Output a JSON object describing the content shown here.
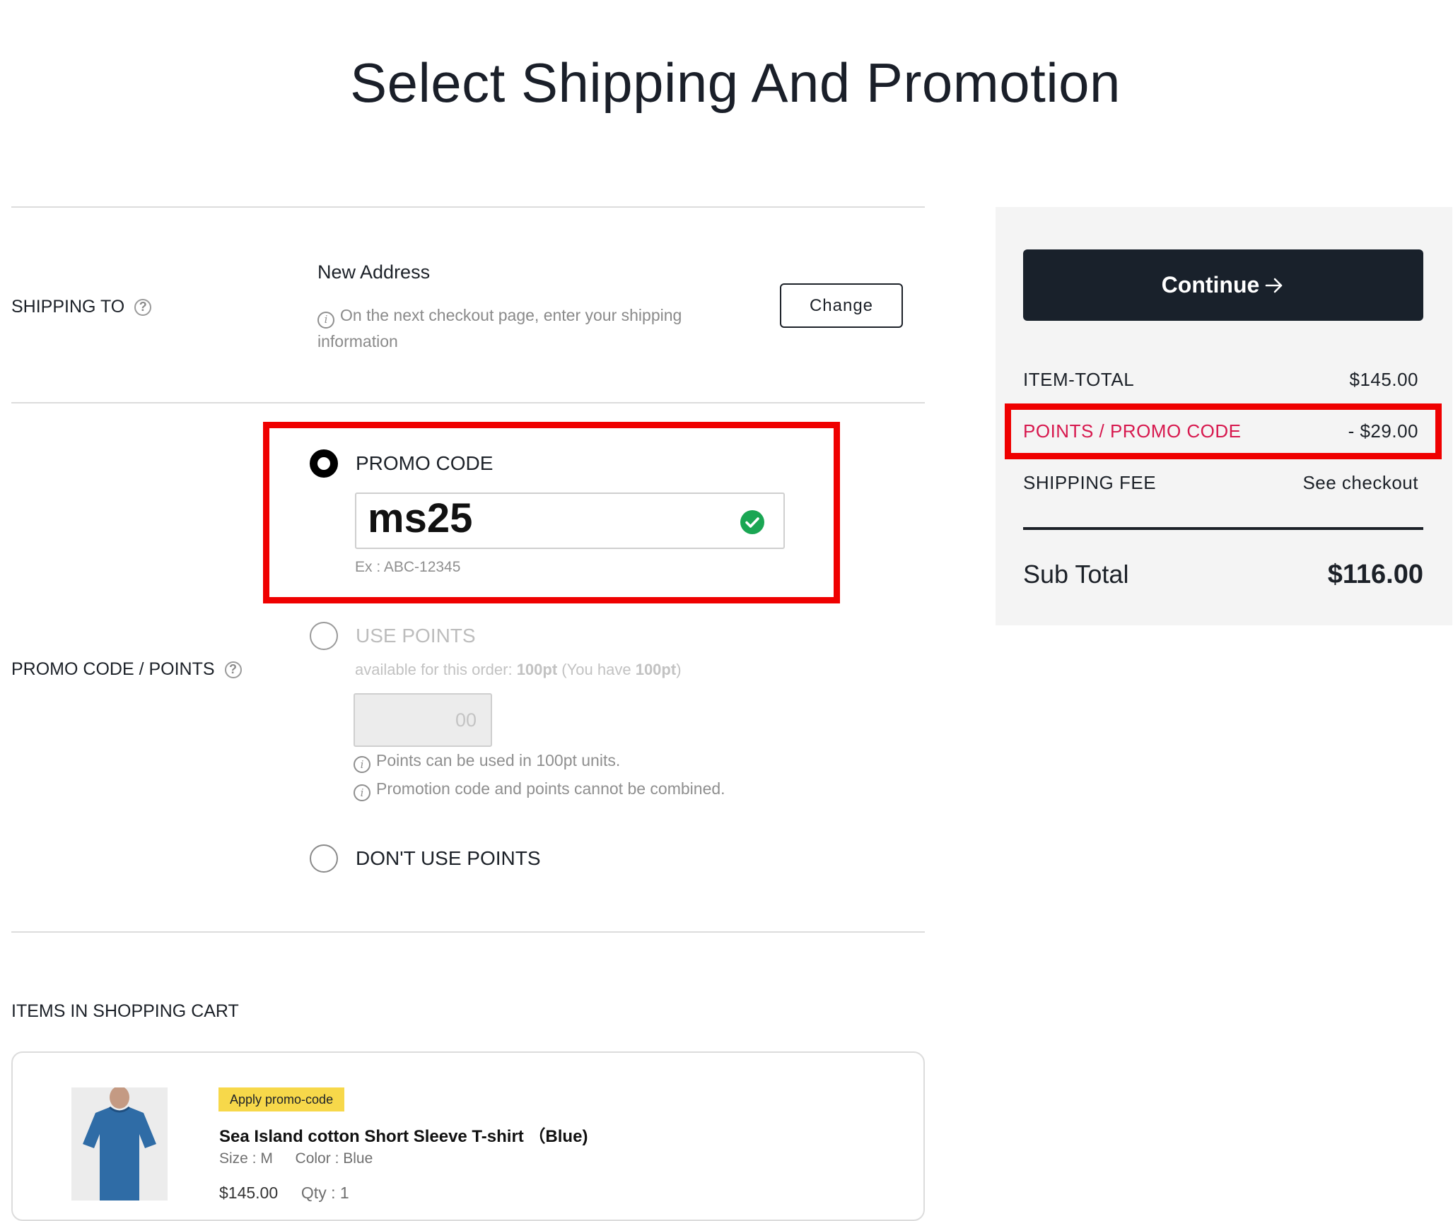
{
  "page": {
    "title": "Select Shipping And Promotion"
  },
  "shipping": {
    "label": "SHIPPING TO",
    "address_title": "New Address",
    "note_line1": "On the next checkout page, enter your shipping",
    "note_line2": "information",
    "change_label": "Change"
  },
  "promo": {
    "section_label": "PROMO CODE / POINTS",
    "options": {
      "promo_code": {
        "label": "PROMO CODE",
        "selected": true
      },
      "use_points": {
        "label": "USE POINTS",
        "selected": false
      },
      "dont_use_points": {
        "label": "DON'T USE POINTS",
        "selected": false
      }
    },
    "code_value": "ms25",
    "code_hint": "Ex : ABC-12345",
    "points": {
      "available_prefix": "available for this order:",
      "available_value": "100pt",
      "you_have_prefix": "(You have",
      "you_have_value": "100pt",
      "you_have_suffix": ")",
      "input_placeholder": "00",
      "note1": "Points can be used in 100pt units.",
      "note2": "Promotion code and points cannot be combined."
    }
  },
  "cart": {
    "section_label": "ITEMS IN SHOPPING CART",
    "item": {
      "badge": "Apply promo-code",
      "name": "Sea Island cotton Short Sleeve T-shirt （Blue)",
      "size": "Size : M",
      "color": "Color : Blue",
      "price": "$145.00",
      "qty": "Qty : 1"
    }
  },
  "summary": {
    "continue_label": "Continue",
    "item_total_label": "ITEM-TOTAL",
    "item_total_value": "$145.00",
    "promo_label": "POINTS / PROMO CODE",
    "promo_value": "- $29.00",
    "shipping_label": "SHIPPING FEE",
    "shipping_value": "See checkout",
    "subtotal_label": "Sub Total",
    "subtotal_value": "$116.00"
  },
  "colors": {
    "highlight_red": "#ef0000",
    "promo_pink": "#d7184e",
    "button_dark": "#19212b",
    "success_green": "#1aa653",
    "badge_yellow": "#f7d84a"
  },
  "icons": {
    "help": "help-circle-icon",
    "info": "info-icon",
    "check": "check-circle-icon",
    "arrow": "arrow-right-icon"
  }
}
